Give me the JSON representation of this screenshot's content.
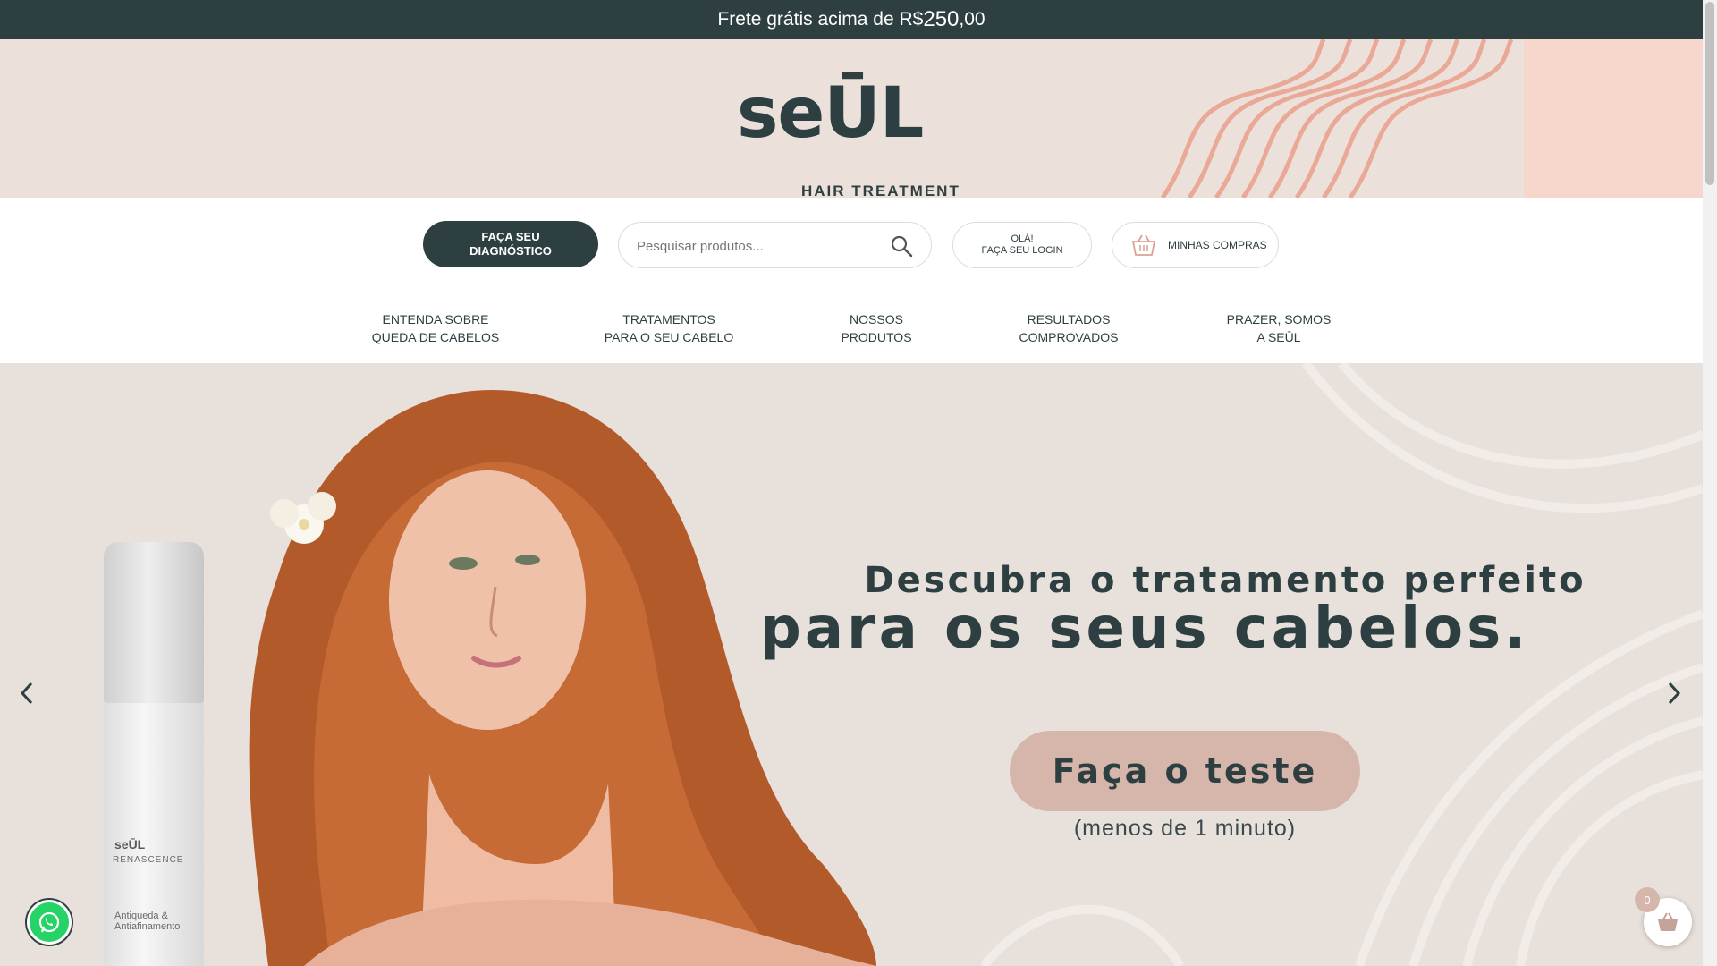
{
  "announcement": {
    "prefix": "Frete grátis acima de R$",
    "amount": "250",
    "cents": ",00"
  },
  "brand": {
    "logo_text": "seŪL",
    "tagline": "HAIR TREATMENT"
  },
  "actions": {
    "diagnostic_label": "FAÇA SEU\nDIAGNÓSTICO",
    "search_placeholder": "Pesquisar produtos...",
    "login_label": "OLÁ!\nFAÇA SEU LOGIN",
    "cart_label": "MINHAS COMPRAS"
  },
  "nav": {
    "items": [
      {
        "label": "ENTENDA SOBRE\nQUEDA DE CABELOS"
      },
      {
        "label": "TRATAMENTOS\nPARA O SEU CABELO"
      },
      {
        "label": "NOSSOS\nPRODUTOS"
      },
      {
        "label": "RESULTADOS\nCOMPROVADOS"
      },
      {
        "label": "PRAZER, SOMOS\nA SEŪL"
      }
    ]
  },
  "hero": {
    "headline_1": "Descubra o tratamento perfeito",
    "headline_2": "para os seus cabelos.",
    "cta_label": "Faça o teste",
    "cta_sub": "(menos de 1 minuto)",
    "product": {
      "brand": "seŪL",
      "line": "RENASCENCE",
      "desc": "Antiqueda &\nAntiafinamento"
    }
  },
  "cart": {
    "count": "0"
  },
  "colors": {
    "primary": "#2d3f41",
    "accent": "#d6b6aa",
    "header_bg": "#ece0db",
    "hero_bg": "#e8e0db"
  },
  "icons": {
    "search": "search-icon",
    "basket": "basket-icon",
    "whatsapp": "whatsapp-icon",
    "prev": "chevron-left-icon",
    "next": "chevron-right-icon"
  }
}
